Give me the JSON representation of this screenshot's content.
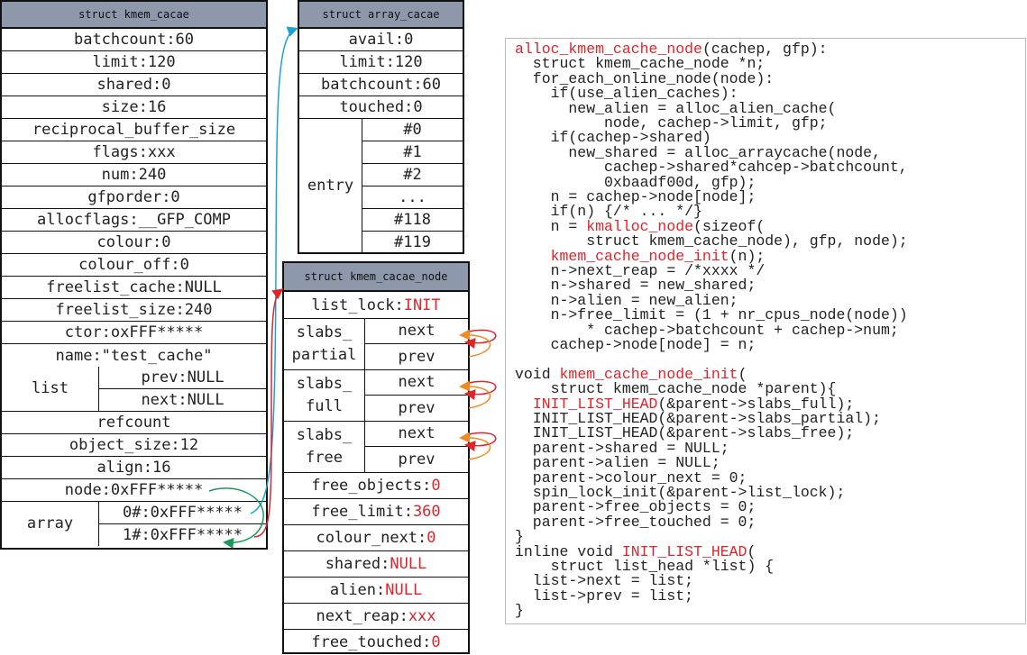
{
  "kmem_cacae": {
    "title": "struct kmem_cacae",
    "rows": [
      "batchcount:60",
      "limit:120",
      "shared:0",
      "size:16",
      "reciprocal_buffer_size",
      "flags:xxx",
      "num:240",
      "gfporder:0",
      "allocflags:__GFP_COMP",
      "colour:0",
      "colour_off:0",
      "freelist_cache:NULL",
      "freelist_size:240",
      "ctor:oxFFF*****",
      "name:\"test_cache\""
    ],
    "list": {
      "label": "list",
      "prev": "prev:NULL",
      "next": "next:NULL"
    },
    "rows2": [
      "refcount",
      "object_size:12",
      "align:16",
      "node:0xFFF*****"
    ],
    "array": {
      "label": "array",
      "e0": "0#:0xFFF*****",
      "e1": "1#:0xFFF*****"
    }
  },
  "array_cacae": {
    "title": "struct array_cacae",
    "rows": [
      "avail:0",
      "limit:120",
      "batchcount:60",
      "touched:0"
    ],
    "entry": {
      "label": "entry",
      "items": [
        "#0",
        "#1",
        "#2",
        "...",
        "#118",
        "#119"
      ]
    }
  },
  "kmem_cacae_node": {
    "title": "struct kmem_cacae_node",
    "list_lock": {
      "key": "list_lock:",
      "val": "INIT"
    },
    "slabs": [
      {
        "l1": "slabs_",
        "l2": "partial",
        "next": "next",
        "prev": "prev"
      },
      {
        "l1": "slabs_",
        "l2": "full",
        "next": "next",
        "prev": "prev"
      },
      {
        "l1": "slabs_",
        "l2": "free",
        "next": "next",
        "prev": "prev"
      }
    ],
    "fields": [
      {
        "key": "free_objects:",
        "val": "0"
      },
      {
        "key": "free_limit:",
        "val": "360"
      },
      {
        "key": "colour_next:",
        "val": "0"
      },
      {
        "key": "shared:",
        "val": "NULL"
      },
      {
        "key": "alien:",
        "val": "NULL"
      },
      {
        "key": "next_reap:",
        "val": "xxx"
      },
      {
        "key": "free_touched:",
        "val": "0"
      }
    ]
  },
  "code": {
    "lines": [
      [
        {
          "t": "alloc_kmem_cache_node",
          "r": true
        },
        {
          "t": "(cachep, gfp):"
        }
      ],
      [
        {
          "t": "  struct kmem_cache_node *n;"
        }
      ],
      [
        {
          "t": "  for_each_online_node(node):"
        }
      ],
      [
        {
          "t": "    if(use_alien_caches):"
        }
      ],
      [
        {
          "t": "      new_alien = alloc_alien_cache("
        }
      ],
      [
        {
          "t": "          node, cachep->limit, gfp;"
        }
      ],
      [
        {
          "t": "    if(cachep->shared)"
        }
      ],
      [
        {
          "t": "      new_shared = alloc_arraycache(node,"
        }
      ],
      [
        {
          "t": "          cachep->shared*cahcep->batchcount,"
        }
      ],
      [
        {
          "t": "          0xbaadf00d, gfp);"
        }
      ],
      [
        {
          "t": "    n = cachep->node[node];"
        }
      ],
      [
        {
          "t": "    if(n) {/* ... */}"
        }
      ],
      [
        {
          "t": "    n = "
        },
        {
          "t": "kmalloc_node",
          "r": true
        },
        {
          "t": "(sizeof("
        }
      ],
      [
        {
          "t": "        struct kmem_cache_node), gfp, node);"
        }
      ],
      [
        {
          "t": "    "
        },
        {
          "t": "kmem_cache_node_init",
          "r": true
        },
        {
          "t": "(n);"
        }
      ],
      [
        {
          "t": "    n->next_reap = /*xxxx */"
        }
      ],
      [
        {
          "t": "    n->shared = new_shared;"
        }
      ],
      [
        {
          "t": "    n->alien = new_alien;"
        }
      ],
      [
        {
          "t": "    n->free_limit = (1 + nr_cpus_node(node))"
        }
      ],
      [
        {
          "t": "        * cachep->batchcount + cachep->num;"
        }
      ],
      [
        {
          "t": "    cachep->node[node] = n;"
        }
      ],
      [
        {
          "t": ""
        }
      ],
      [
        {
          "t": "void "
        },
        {
          "t": "kmem_cache_node_init",
          "r": true
        },
        {
          "t": "("
        }
      ],
      [
        {
          "t": "    struct kmem_cache_node *parent){"
        }
      ],
      [
        {
          "t": "  "
        },
        {
          "t": "INIT_LIST_HEAD",
          "r": true
        },
        {
          "t": "(&parent->slabs_full);"
        }
      ],
      [
        {
          "t": "  INIT_LIST_HEAD(&parent->slabs_partial);"
        }
      ],
      [
        {
          "t": "  INIT_LIST_HEAD(&parent->slabs_free);"
        }
      ],
      [
        {
          "t": "  parent->shared = NULL;"
        }
      ],
      [
        {
          "t": "  parent->alien = NULL;"
        }
      ],
      [
        {
          "t": "  parent->colour_next = 0;"
        }
      ],
      [
        {
          "t": "  spin_lock_init(&parent->list_lock);"
        }
      ],
      [
        {
          "t": "  parent->free_objects = 0;"
        }
      ],
      [
        {
          "t": "  parent->free_touched = 0;"
        }
      ],
      [
        {
          "t": "}"
        }
      ],
      [
        {
          "t": "inline void "
        },
        {
          "t": "INIT_LIST_HEAD",
          "r": true
        },
        {
          "t": "("
        }
      ],
      [
        {
          "t": "    struct list_head *list) {"
        }
      ],
      [
        {
          "t": "  list->next = list;"
        }
      ],
      [
        {
          "t": "  list->prev = list;"
        }
      ],
      [
        {
          "t": "}"
        }
      ]
    ]
  },
  "colors": {
    "header": "#8d98aa",
    "highlight": "#e0242b",
    "arrow_blue": "#1aa3d8",
    "arrow_green": "#1a9a5a",
    "arrow_red": "#e0242b",
    "arrow_orange": "#f08a24"
  }
}
